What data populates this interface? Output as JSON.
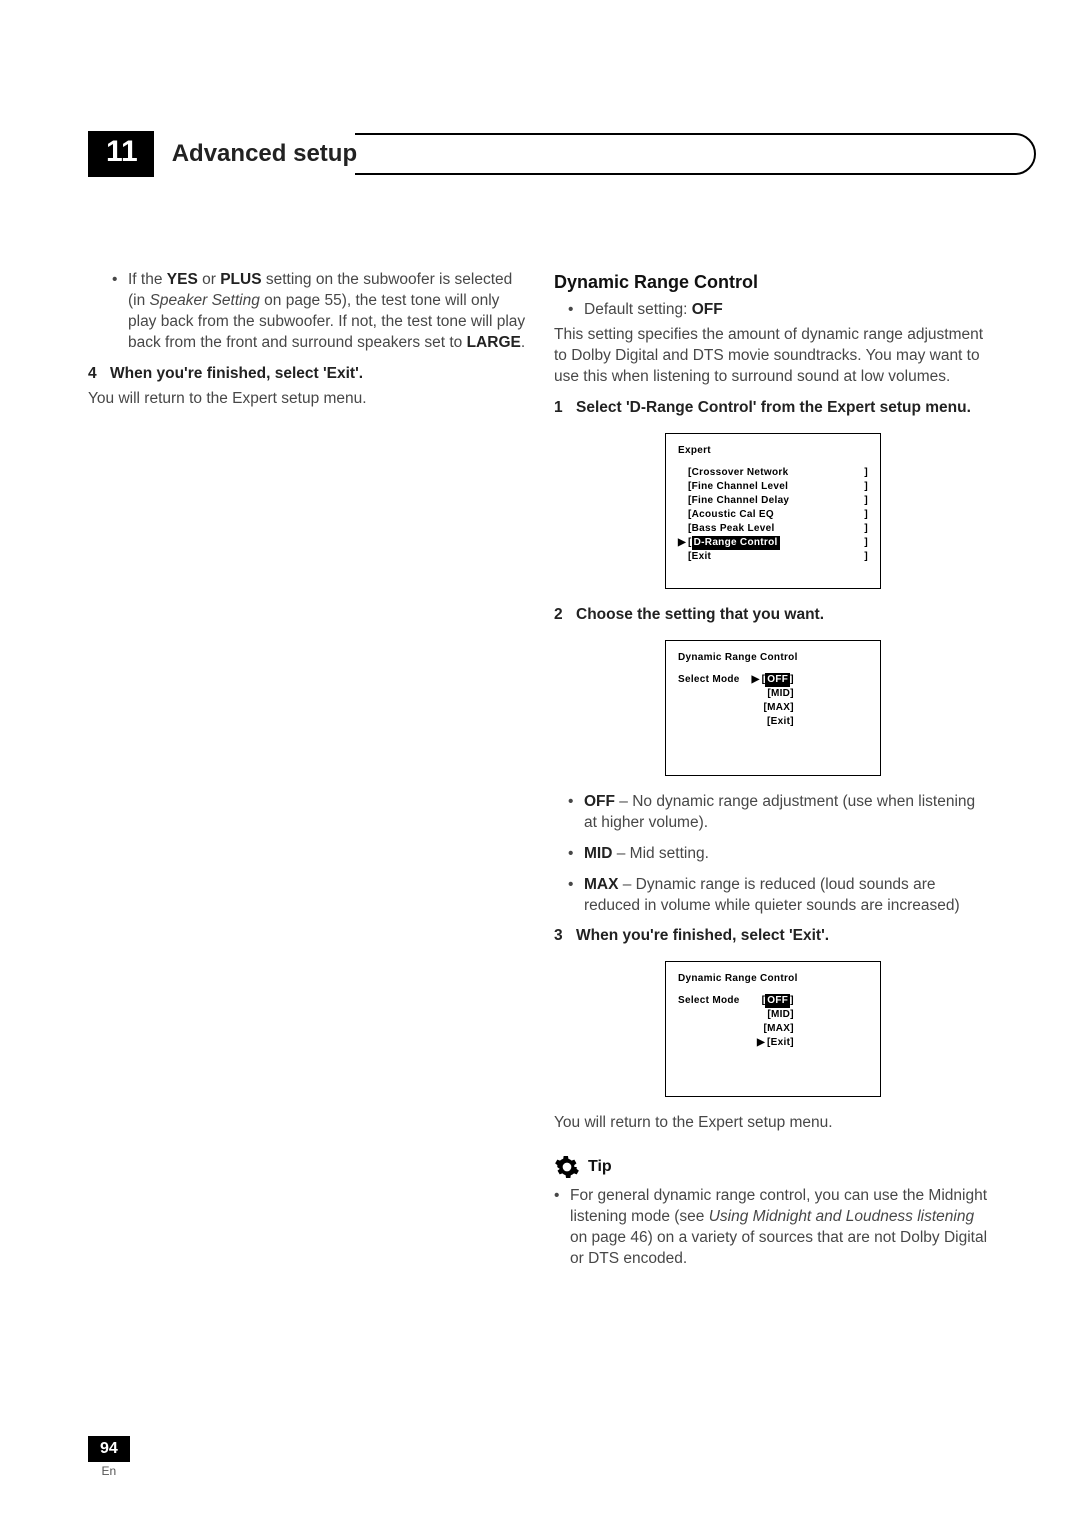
{
  "chapter": {
    "number": "11",
    "title": "Advanced setup"
  },
  "left": {
    "bullet1_pre": "If the ",
    "bullet1_b1": "YES",
    "bullet1_mid1": " or ",
    "bullet1_b2": "PLUS",
    "bullet1_mid2": " setting on the subwoofer is selected (in ",
    "bullet1_i1": "Speaker Setting",
    "bullet1_mid3": " on page 55), the test tone will only play back from the subwoofer. If not, the test tone will play back from the front and surround speakers set to ",
    "bullet1_b3": "LARGE",
    "bullet1_end": ".",
    "step4_num": "4",
    "step4": "When you're finished, select 'Exit'.",
    "step4_after": "You will return to the Expert setup menu."
  },
  "right": {
    "heading": "Dynamic Range Control",
    "default_pre": "Default setting: ",
    "default_val": "OFF",
    "intro": "This setting specifies the amount of dynamic range adjustment to Dolby Digital and DTS movie soundtracks. You may want to use this when listening to surround sound at low volumes.",
    "step1_num": "1",
    "step1": "Select 'D-Range Control' from the Expert setup menu.",
    "osd1": {
      "title": "Expert",
      "items": [
        "Crossover Network",
        "Fine Channel Level",
        "Fine Channel Delay",
        "Acoustic Cal EQ",
        "Bass Peak Level",
        "D-Range Control",
        "Exit"
      ],
      "selected_index": 5
    },
    "step2_num": "2",
    "step2": "Choose the setting that you want.",
    "osd2": {
      "title": "Dynamic  Range  Control",
      "mode_label": "Select  Mode",
      "options": [
        "OFF",
        "MID",
        "MAX",
        "Exit"
      ],
      "highlight_index": 0,
      "pointer_index": 0
    },
    "opt_off_b": "OFF",
    "opt_off": " – No dynamic range adjustment (use when listening at higher volume).",
    "opt_mid_b": "MID",
    "opt_mid": " – Mid setting.",
    "opt_max_b": "MAX",
    "opt_max": " – Dynamic range is reduced (loud sounds are reduced in volume while quieter sounds are increased)",
    "step3_num": "3",
    "step3": "When you're finished, select 'Exit'.",
    "osd3": {
      "title": "Dynamic  Range  Control",
      "mode_label": "Select  Mode",
      "options": [
        "OFF",
        "MID",
        "MAX",
        "Exit"
      ],
      "highlight_index": 0,
      "pointer_index": 3
    },
    "after_step3": "You will return to the Expert setup menu.",
    "tip_label": "Tip",
    "tip_pre": "For general dynamic range control, you can use the Midnight listening mode (see ",
    "tip_i": "Using Midnight and Loudness listening",
    "tip_post": " on page 46) on a variety of sources that are not Dolby Digital or DTS encoded."
  },
  "footer": {
    "page": "94",
    "lang": "En"
  }
}
